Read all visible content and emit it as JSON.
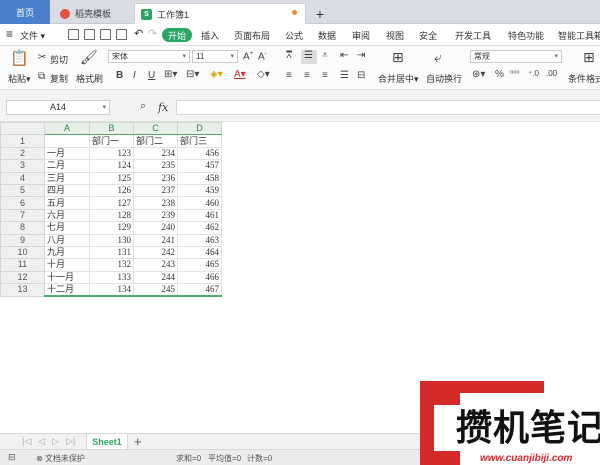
{
  "tabs": {
    "home": "首页",
    "docer": "稻壳模板",
    "workbook": "工作簿1",
    "add": "+"
  },
  "menu": {
    "file": "文件",
    "start": "开始",
    "items": [
      "插入",
      "页面布局",
      "公式",
      "数据",
      "审阅",
      "视图",
      "安全",
      "开发工具",
      "特色功能",
      "智能工具箱"
    ]
  },
  "ribbon": {
    "paste": "粘贴",
    "cut": "剪切",
    "copy": "复制",
    "format_painter": "格式刷",
    "font_name": "宋体",
    "font_size": "11",
    "merge_center": "合并居中",
    "wrap_text": "自动换行",
    "number_format": "常规",
    "conditional_format": "条件格式"
  },
  "formula_bar": {
    "cell_ref": "A14",
    "fx": "fx",
    "value": ""
  },
  "grid": {
    "columns": [
      "A",
      "B",
      "C",
      "D"
    ],
    "header_row": [
      "",
      "部门一",
      "部门二",
      "部门三"
    ],
    "rows": [
      [
        "一月",
        "123",
        "234",
        "456"
      ],
      [
        "二月",
        "124",
        "235",
        "457"
      ],
      [
        "三月",
        "125",
        "236",
        "458"
      ],
      [
        "四月",
        "126",
        "237",
        "459"
      ],
      [
        "五月",
        "127",
        "238",
        "460"
      ],
      [
        "六月",
        "128",
        "239",
        "461"
      ],
      [
        "七月",
        "129",
        "240",
        "462"
      ],
      [
        "八月",
        "130",
        "241",
        "463"
      ],
      [
        "九月",
        "131",
        "242",
        "464"
      ],
      [
        "十月",
        "132",
        "243",
        "465"
      ],
      [
        "十一月",
        "133",
        "244",
        "466"
      ],
      [
        "十二月",
        "134",
        "245",
        "467"
      ]
    ]
  },
  "sheets": {
    "active": "Sheet1",
    "add": "+"
  },
  "status": {
    "protect": "文档未保护",
    "sum": "求和=0",
    "avg": "平均值=0",
    "count": "计数=0"
  },
  "watermark": {
    "text": "攒机笔记",
    "url": "www.cuanjibiji.com"
  },
  "colors": {
    "accent_green": "#2aa663",
    "tab_blue": "#4a7fc9",
    "watermark_red": "#d42a2a"
  }
}
